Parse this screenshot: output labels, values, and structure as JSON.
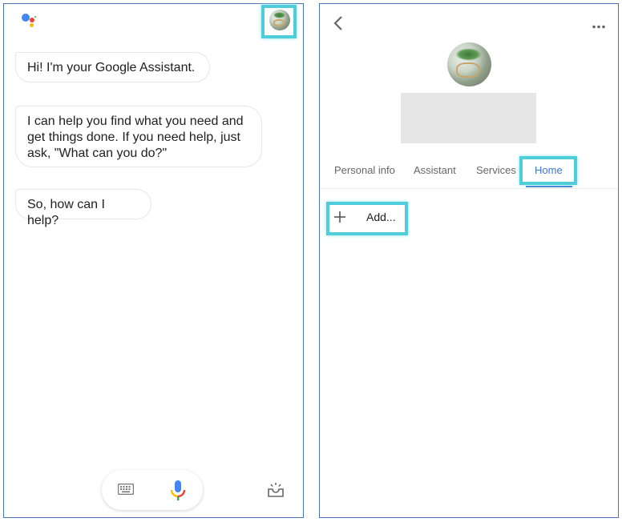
{
  "assistant": {
    "logo": "google-assistant-logo",
    "colors": {
      "blue": "#4285f4",
      "red": "#ea4335",
      "yellow": "#fbbc05",
      "green": "#34a853"
    },
    "messages": [
      {
        "text": "Hi! I'm your Google Assistant."
      },
      {
        "text": "I can help you find what you need and get things done. If you need help, just ask, \"What can you do?\""
      },
      {
        "text": "So, how can I help?"
      }
    ],
    "bottom_bar": {
      "keyboard_icon": "keyboard-icon",
      "mic_icon": "microphone-icon",
      "explore_icon": "explore-tray-icon"
    },
    "profile_icon": "profile-avatar"
  },
  "profile": {
    "back_icon": "chevron-left-icon",
    "more_icon": "more-horizontal-icon",
    "tabs": [
      {
        "label": "Personal info",
        "active": false
      },
      {
        "label": "Assistant",
        "active": false
      },
      {
        "label": "Services",
        "active": false
      },
      {
        "label": "Home",
        "active": true
      }
    ],
    "add_item": {
      "icon": "plus-icon",
      "label": "Add..."
    },
    "accent_color": "#3a78d8",
    "highlight_color": "#4fcdd9"
  }
}
